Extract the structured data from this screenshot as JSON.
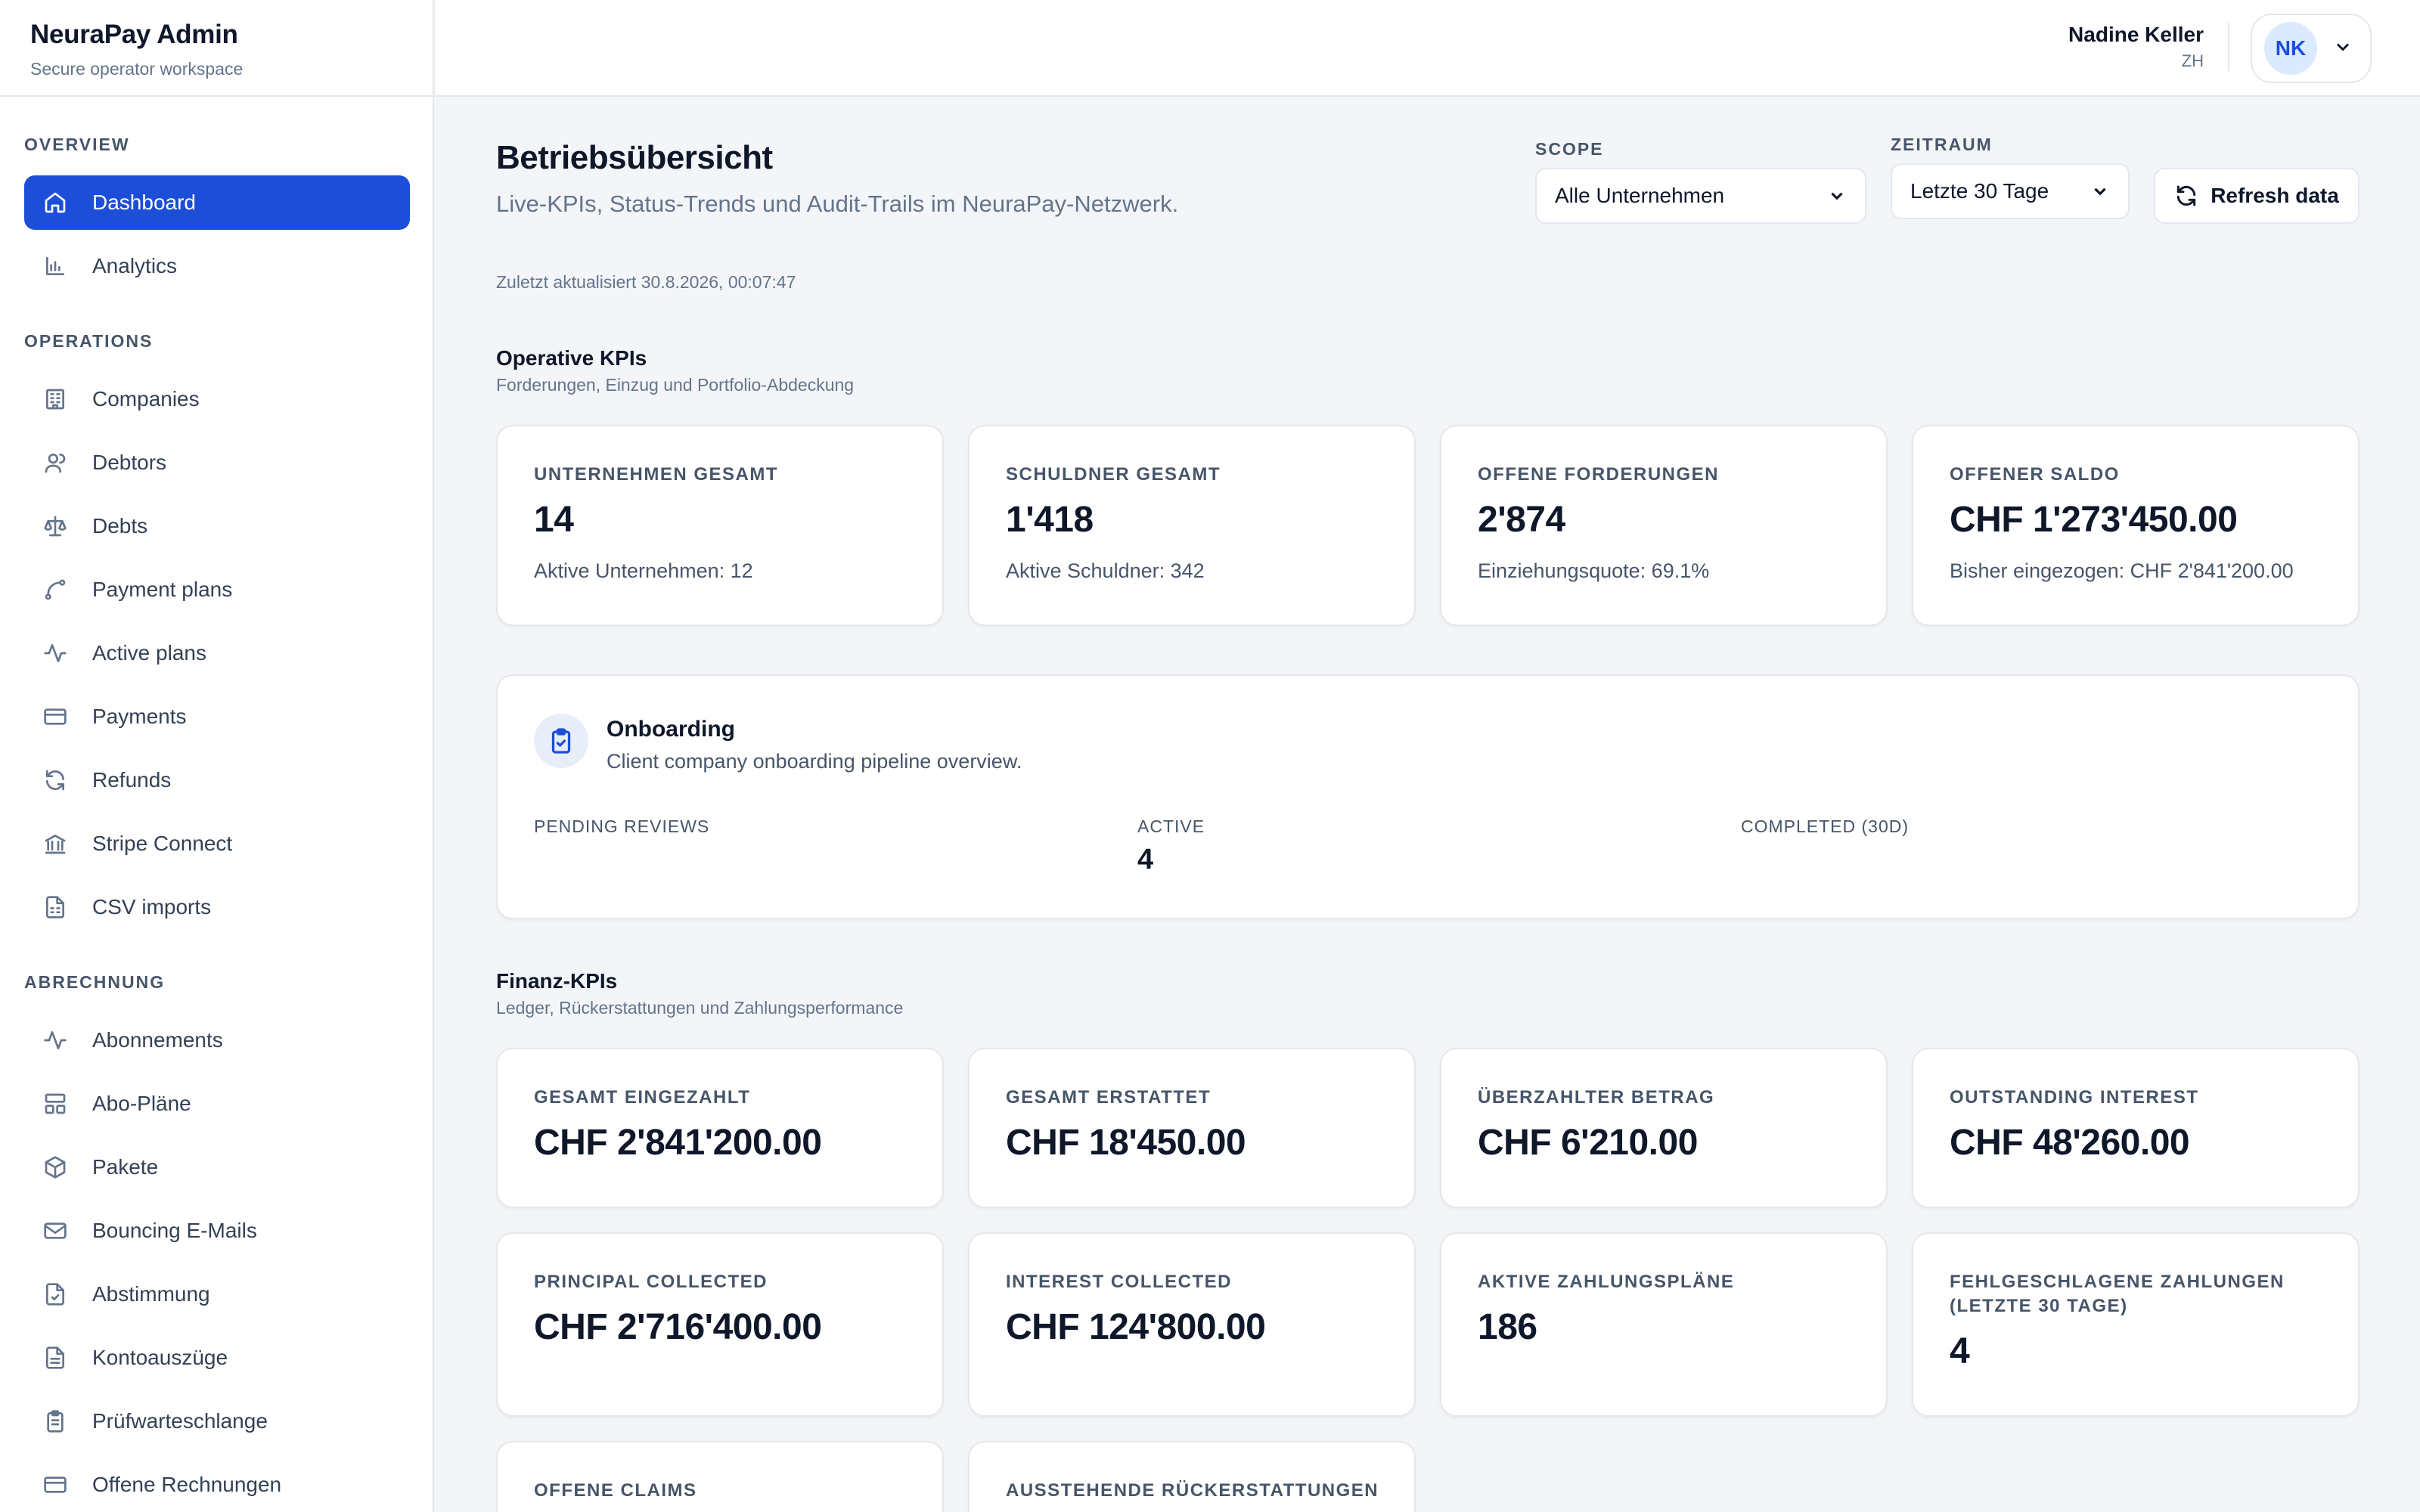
{
  "brand": {
    "title": "NeuraPay Admin",
    "subtitle": "Secure operator workspace"
  },
  "sidebar": {
    "sections": [
      "OVERVIEW",
      "OPERATIONS",
      "ABRECHNUNG"
    ],
    "items": [
      {
        "label": "Dashboard",
        "icon": "home-icon",
        "active": true
      },
      {
        "label": "Analytics",
        "icon": "bar-chart-icon"
      },
      {
        "label": "Companies",
        "icon": "building-icon"
      },
      {
        "label": "Debtors",
        "icon": "users-icon"
      },
      {
        "label": "Debts",
        "icon": "scale-icon"
      },
      {
        "label": "Payment plans",
        "icon": "route-icon"
      },
      {
        "label": "Active plans",
        "icon": "activity-icon"
      },
      {
        "label": "Payments",
        "icon": "credit-card-icon"
      },
      {
        "label": "Refunds",
        "icon": "refresh-icon"
      },
      {
        "label": "Stripe Connect",
        "icon": "bank-icon"
      },
      {
        "label": "CSV imports",
        "icon": "file-spreadsheet-icon"
      },
      {
        "label": "Abonnements",
        "icon": "activity-icon"
      },
      {
        "label": "Abo-Pläne",
        "icon": "layout-icon"
      },
      {
        "label": "Pakete",
        "icon": "package-icon"
      },
      {
        "label": "Bouncing E-Mails",
        "icon": "mail-warning-icon"
      },
      {
        "label": "Abstimmung",
        "icon": "file-check-icon"
      },
      {
        "label": "Kontoauszüge",
        "icon": "file-text-icon"
      },
      {
        "label": "Prüfwarteschlange",
        "icon": "clipboard-list-icon"
      },
      {
        "label": "Offene Rechnungen",
        "icon": "credit-card-icon"
      }
    ]
  },
  "user": {
    "name": "Nadine Keller",
    "location": "ZH",
    "initials": "NK"
  },
  "header": {
    "title": "Betriebsübersicht",
    "subtitle": "Live-KPIs, Status-Trends und Audit-Trails im NeuraPay-Netzwerk.",
    "updated": "Zuletzt aktualisiert 30.8.2026, 00:07:47"
  },
  "controls": {
    "scope_label": "SCOPE",
    "scope_value": "Alle Unternehmen",
    "period_label": "ZEITRAUM",
    "period_value": "Letzte 30 Tage",
    "refresh_label": "Refresh data"
  },
  "operative": {
    "title": "Operative KPIs",
    "subtitle": "Forderungen, Einzug und Portfolio-Abdeckung",
    "cards": [
      {
        "label": "UNTERNEHMEN GESAMT",
        "value": "14",
        "note": "Aktive Unternehmen: 12"
      },
      {
        "label": "SCHULDNER GESAMT",
        "value": "1'418",
        "note": "Aktive Schuldner: 342"
      },
      {
        "label": "OFFENE FORDERUNGEN",
        "value": "2'874",
        "note": "Einziehungsquote: 69.1%"
      },
      {
        "label": "OFFENER SALDO",
        "value": "CHF 1'273'450.00",
        "note": "Bisher eingezogen: CHF 2'841'200.00"
      }
    ]
  },
  "onboarding": {
    "title": "Onboarding",
    "subtitle": "Client company onboarding pipeline overview.",
    "stats": [
      {
        "label": "PENDING REVIEWS",
        "value": ""
      },
      {
        "label": "ACTIVE",
        "value": "4"
      },
      {
        "label": "COMPLETED (30D)",
        "value": ""
      }
    ]
  },
  "finance": {
    "title": "Finanz-KPIs",
    "subtitle": "Ledger, Rückerstattungen und Zahlungsperformance",
    "cards": [
      {
        "label": "GESAMT EINGEZAHLT",
        "value": "CHF 2'841'200.00"
      },
      {
        "label": "GESAMT ERSTATTET",
        "value": "CHF 18'450.00"
      },
      {
        "label": "ÜBERZAHLTER BETRAG",
        "value": "CHF 6'210.00"
      },
      {
        "label": "OUTSTANDING INTEREST",
        "value": "CHF 48'260.00"
      },
      {
        "label": "PRINCIPAL COLLECTED",
        "value": "CHF 2'716'400.00"
      },
      {
        "label": "INTEREST COLLECTED",
        "value": "CHF 124'800.00"
      },
      {
        "label": "AKTIVE ZAHLUNGSPLÄNE",
        "value": "186"
      },
      {
        "label": "FEHLGESCHLAGENE ZAHLUNGEN (LETZTE 30 TAGE)",
        "value": "4"
      },
      {
        "label": "OFFENE CLAIMS",
        "value": ""
      },
      {
        "label": "AUSSTEHENDE RÜCKERSTATTUNGEN",
        "value": ""
      }
    ]
  }
}
